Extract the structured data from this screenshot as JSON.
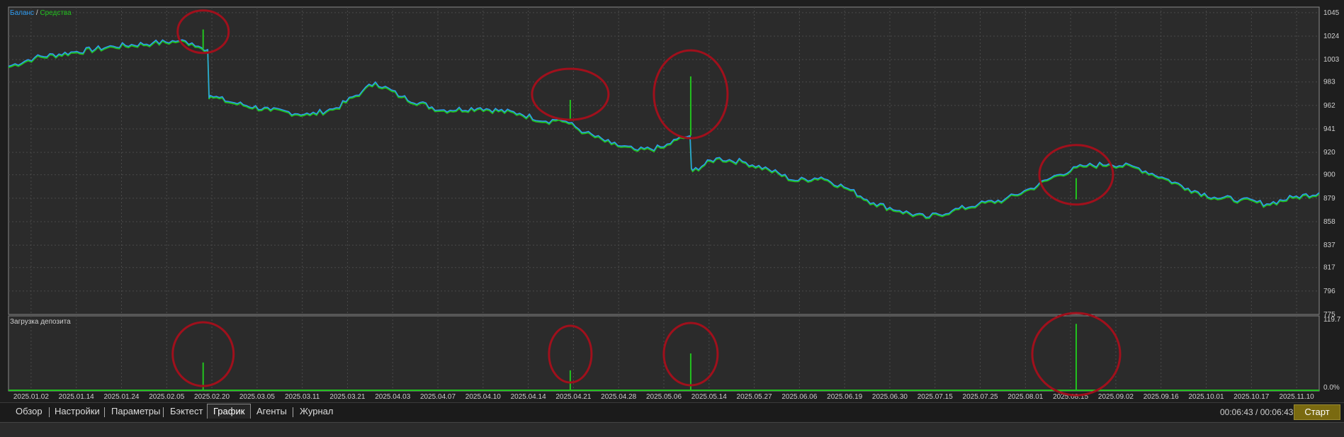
{
  "main_panel": {
    "legend_balance": "Баланс",
    "legend_sep": " / ",
    "legend_equity": "Средства"
  },
  "load_panel": {
    "title": "Загрузка депозита"
  },
  "tabs": [
    {
      "label": "Обзор"
    },
    {
      "label": "Настройки"
    },
    {
      "label": "Параметры"
    },
    {
      "label": "Бэктест"
    },
    {
      "label": "График",
      "active": true
    },
    {
      "label": "Агенты"
    },
    {
      "label": "Журнал"
    }
  ],
  "timer": "00:06:43 / 00:06:43",
  "start_label": "Старт",
  "colors": {
    "balance": "#2e9bf0",
    "equity": "#22c21e",
    "annotation": "#a0101c",
    "grid": "#4a4a4a",
    "background": "#2b2b2b",
    "start_button": "#7a6a10"
  },
  "chart_data": [
    {
      "type": "line",
      "name": "balance-equity",
      "ylim": [
        775,
        1050
      ],
      "y_ticks": [
        "1045",
        "1024",
        "1003",
        "983",
        "962",
        "941",
        "920",
        "900",
        "879",
        "858",
        "837",
        "817",
        "796",
        "775"
      ],
      "x_ticks": [
        "2025.01.02",
        "2025.01.14",
        "2025.01.24",
        "2025.02.05",
        "2025.02.20",
        "2025.03.05",
        "2025.03.11",
        "2025.03.21",
        "2025.04.03",
        "2025.04.07",
        "2025.04.10",
        "2025.04.14",
        "2025.04.21",
        "2025.04.28",
        "2025.05.06",
        "2025.05.14",
        "2025.05.27",
        "2025.06.06",
        "2025.06.19",
        "2025.06.30",
        "2025.07.15",
        "2025.07.25",
        "2025.08.01",
        "2025.08.15",
        "2025.09.02",
        "2025.09.16",
        "2025.10.01",
        "2025.10.17",
        "2025.11.10"
      ],
      "series": [
        {
          "name": "Баланс",
          "x": [
            0,
            0.02,
            0.05,
            0.08,
            0.11,
            0.13,
            0.14,
            0.145,
            0.152,
            0.154,
            0.17,
            0.2,
            0.23,
            0.25,
            0.27,
            0.28,
            0.3,
            0.33,
            0.36,
            0.39,
            0.41,
            0.42,
            0.425,
            0.44,
            0.46,
            0.48,
            0.5,
            0.51,
            0.52,
            0.522,
            0.54,
            0.56,
            0.58,
            0.6,
            0.62,
            0.64,
            0.66,
            0.68,
            0.7,
            0.72,
            0.74,
            0.76,
            0.78,
            0.8,
            0.82,
            0.84,
            0.86,
            0.88,
            0.9,
            0.92,
            0.94,
            0.96,
            0.98,
            1.0
          ],
          "y": [
            997,
            1005,
            1010,
            1015,
            1018,
            1020,
            1018,
            1015,
            1012,
            971,
            965,
            958,
            954,
            960,
            975,
            983,
            970,
            958,
            960,
            955,
            948,
            950,
            948,
            938,
            928,
            922,
            925,
            932,
            935,
            904,
            915,
            912,
            905,
            895,
            898,
            888,
            875,
            868,
            862,
            868,
            874,
            878,
            888,
            900,
            908,
            910,
            907,
            898,
            888,
            880,
            878,
            874,
            880,
            884
          ]
        },
        {
          "name": "Средства",
          "x": [
            0,
            0.02,
            0.05,
            0.08,
            0.11,
            0.13,
            0.14,
            0.145,
            0.152,
            0.154,
            0.17,
            0.2,
            0.23,
            0.25,
            0.27,
            0.28,
            0.3,
            0.33,
            0.36,
            0.39,
            0.41,
            0.42,
            0.425,
            0.44,
            0.46,
            0.48,
            0.5,
            0.51,
            0.52,
            0.522,
            0.54,
            0.56,
            0.58,
            0.6,
            0.62,
            0.64,
            0.66,
            0.68,
            0.7,
            0.72,
            0.74,
            0.76,
            0.78,
            0.8,
            0.82,
            0.84,
            0.86,
            0.88,
            0.9,
            0.92,
            0.94,
            0.96,
            0.98,
            1.0
          ],
          "y": [
            996,
            1004,
            1009,
            1014,
            1017,
            1019,
            1017,
            1014,
            1011,
            970,
            964,
            957,
            953,
            959,
            974,
            982,
            969,
            957,
            959,
            954,
            947,
            949,
            947,
            937,
            927,
            921,
            924,
            931,
            934,
            903,
            914,
            911,
            904,
            894,
            897,
            887,
            874,
            867,
            861,
            867,
            873,
            877,
            887,
            899,
            907,
            909,
            906,
            897,
            887,
            879,
            877,
            873,
            879,
            883
          ]
        }
      ],
      "spikes": [
        {
          "x": 0.1485,
          "low": 1012,
          "high": 1030
        },
        {
          "x": 0.4286,
          "low": 950,
          "high": 967
        },
        {
          "x": 0.5205,
          "low": 935,
          "high": 988
        },
        {
          "x": 0.8146,
          "low": 878,
          "high": 897
        }
      ]
    },
    {
      "type": "bar",
      "name": "Загрузка депозита",
      "y_ticks": [
        "119.7",
        "0.0%"
      ],
      "ylim": [
        0,
        119.7
      ],
      "spikes": [
        {
          "x": 0.1485,
          "value": 46
        },
        {
          "x": 0.4286,
          "value": 33
        },
        {
          "x": 0.5205,
          "value": 61
        },
        {
          "x": 0.8146,
          "value": 110
        }
      ]
    }
  ]
}
